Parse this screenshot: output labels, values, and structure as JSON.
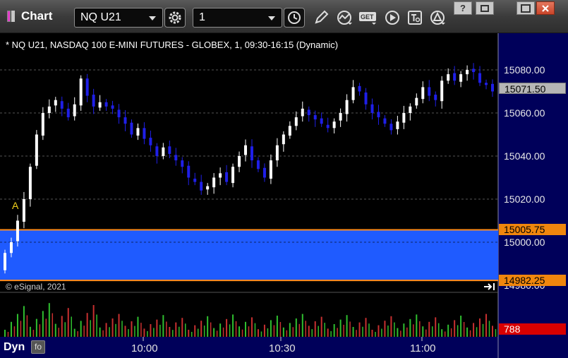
{
  "toolbar": {
    "title": "Chart",
    "symbol": "NQ U21",
    "interval": "1",
    "icons": [
      "symbol-settings-gear-icon",
      "time-clock-icon",
      "pencil-draw-icon",
      "studies-chart-icon",
      "get-data-icon",
      "play-icon",
      "text-tool-icon",
      "alert-triangle-icon"
    ]
  },
  "window_buttons": [
    "help-icon",
    "restore-icon",
    "maximize-icon",
    "close-icon"
  ],
  "chart": {
    "title": "* NQ U21, NASDAQ 100 E-MINI FUTURES - GLOBEX, 1, 09:30-16:15 (Dynamic)",
    "copyright": "© eSignal, 2021",
    "marker_text": "A",
    "price_axis": [
      "15080.00",
      "15060.00",
      "15040.00",
      "15020.00",
      "15000.00",
      "14980.00"
    ],
    "last_price": "15071.50",
    "band_high": "15005.75",
    "band_low": "14982.25",
    "volume_last": "788",
    "time_axis": [
      "10:00",
      "10:30",
      "11:00"
    ],
    "panel_label": "Dyn",
    "fx_label": "fo"
  },
  "colors": {
    "up_bar": "#ffffff",
    "down_bar": "#1f1fe8",
    "band_fill": "#1f5bff",
    "band_edge": "#ff8c1a",
    "volume_up": "#2fbf2f",
    "volume_down": "#c83030",
    "axis_bg": "#00005a"
  },
  "chart_data": {
    "type": "candlestick",
    "y_unit": "price",
    "ylim": [
      14980,
      15085
    ],
    "x_labels": [
      "10:00",
      "10:30",
      "11:00"
    ],
    "bars_note": "1-minute OHLC bars from 09:30 to approx 11:18",
    "close_series": [
      14995,
      15000,
      15010,
      15020,
      15035,
      15050,
      15060,
      15063,
      15066,
      15062,
      15058,
      15064,
      15076,
      15068,
      15063,
      15065,
      15063,
      15062,
      15058,
      15055,
      15050,
      15053,
      15048,
      15045,
      15040,
      15044,
      15041,
      15038,
      15035,
      15030,
      15028,
      15024,
      15026,
      15030,
      15032,
      15028,
      15035,
      15040,
      15045,
      15038,
      15034,
      15030,
      15038,
      15045,
      15050,
      15054,
      15058,
      15062,
      15059,
      15057,
      15055,
      15053,
      15056,
      15060,
      15066,
      15072,
      15070,
      15064,
      15060,
      15058,
      15055,
      15052,
      15056,
      15060,
      15063,
      15067,
      15072,
      15068,
      15066,
      15075,
      15078,
      15075,
      15078,
      15080,
      15079,
      15074,
      15073,
      15070
    ],
    "band": {
      "high": 15005.75,
      "low": 14982.25
    },
    "last_price": 15071.5,
    "volume_last": 788
  }
}
